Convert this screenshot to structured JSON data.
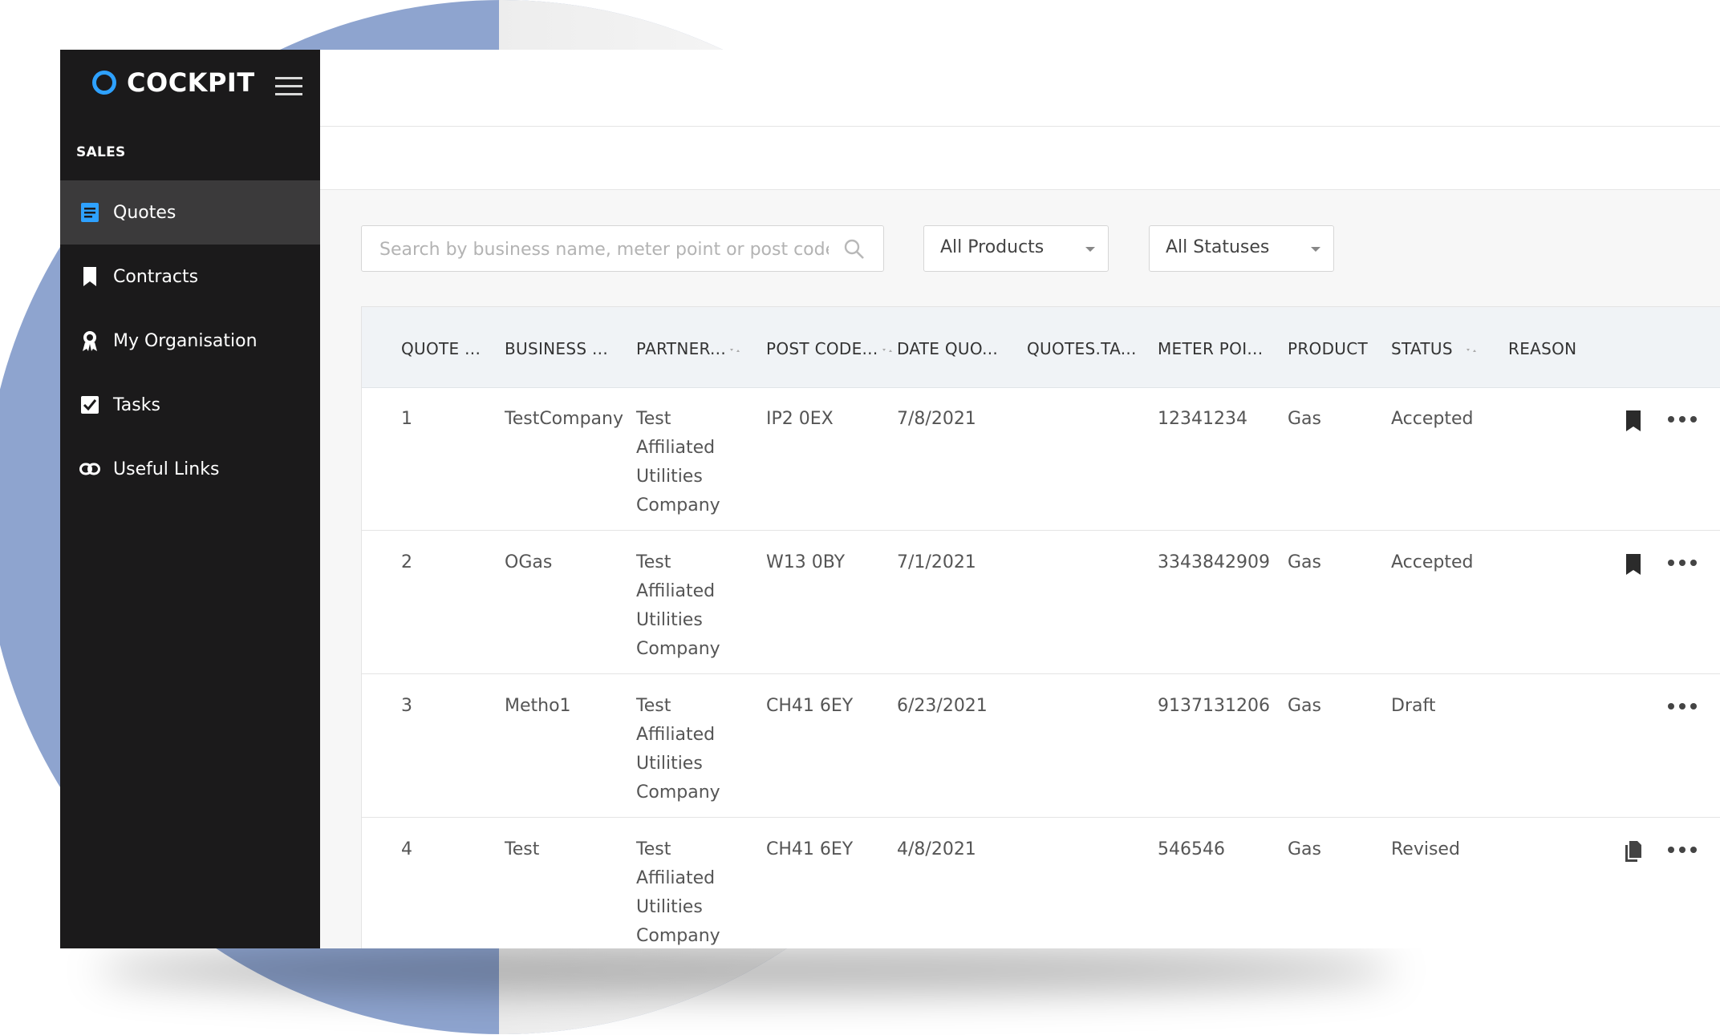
{
  "brand": {
    "name": "COCKPIT"
  },
  "sidebar": {
    "section": "SALES",
    "items": [
      {
        "label": "Quotes",
        "icon": "document-icon",
        "active": true
      },
      {
        "label": "Contracts",
        "icon": "bookmark-icon",
        "active": false
      },
      {
        "label": "My Organisation",
        "icon": "award-icon",
        "active": false
      },
      {
        "label": "Tasks",
        "icon": "checkbox-icon",
        "active": false
      },
      {
        "label": "Useful Links",
        "icon": "link-icon",
        "active": false
      }
    ]
  },
  "filters": {
    "search_placeholder": "Search by business name, meter point or post code",
    "product": "All Products",
    "status": "All Statuses"
  },
  "table": {
    "columns": [
      "QUOTE ...",
      "BUSINESS ...",
      "PARTNER...",
      "POST CODE...",
      "DATE QUO...",
      "QUOTES.TA...",
      "METER POI...",
      "PRODUCT",
      "STATUS",
      "REASON"
    ],
    "rows": [
      {
        "quote": "1",
        "business": "TestCompany",
        "partner": "Test Affiliated Utilities Company",
        "postcode": "IP2 0EX",
        "date": "7/8/2021",
        "tax": "",
        "meter": "12341234",
        "product": "Gas",
        "status": "Accepted",
        "reason": "",
        "action_icon": "bookmark-icon"
      },
      {
        "quote": "2",
        "business": "OGas",
        "partner": "Test Affiliated Utilities Company",
        "postcode": "W13 0BY",
        "date": "7/1/2021",
        "tax": "",
        "meter": "3343842909",
        "product": "Gas",
        "status": "Accepted",
        "reason": "",
        "action_icon": "bookmark-icon"
      },
      {
        "quote": "3",
        "business": "Metho1",
        "partner": "Test Affiliated Utilities Company",
        "postcode": "CH41 6EY",
        "date": "6/23/2021",
        "tax": "",
        "meter": "9137131206",
        "product": "Gas",
        "status": "Draft",
        "reason": "",
        "action_icon": ""
      },
      {
        "quote": "4",
        "business": "Test",
        "partner": "Test Affiliated Utilities Company",
        "postcode": "CH41 6EY",
        "date": "4/8/2021",
        "tax": "",
        "meter": "546546",
        "product": "Gas",
        "status": "Revised",
        "reason": "",
        "action_icon": "file-copy-icon"
      }
    ]
  },
  "colors": {
    "sidebar_bg": "#1b1a1b",
    "sidebar_active": "#3b3a3b",
    "brand_accent": "#2ea1ff",
    "backdrop_circle": "#8ea4cf",
    "table_header_bg": "#f0f3f6"
  }
}
